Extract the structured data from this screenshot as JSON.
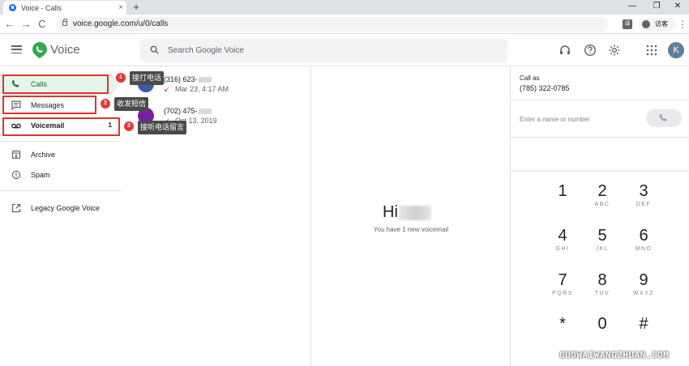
{
  "browser": {
    "tab_title": "Voice - Calls",
    "tab_close": "×",
    "new_tab": "+",
    "minimize": "—",
    "restore": "❐",
    "close": "✕",
    "back": "←",
    "forward": "→",
    "reload": "C",
    "url": "voice.google.com/u/0/calls",
    "translate_icon": "译",
    "profile_label": "访客",
    "menu": "⋮"
  },
  "header": {
    "app_name": "Voice",
    "search_placeholder": "Search Google Voice",
    "avatar_initial": "K"
  },
  "nav": {
    "calls": "Calls",
    "messages": "Messages",
    "voicemail": "Voicemail",
    "voicemail_count": "1",
    "archive": "Archive",
    "spam": "Spam",
    "legacy": "Legacy Google Voice"
  },
  "annotations": [
    {
      "num": "1",
      "text": "接打电话"
    },
    {
      "num": "2",
      "text": "收发短信"
    },
    {
      "num": "3",
      "text": "接听电话留言"
    }
  ],
  "calls": [
    {
      "number": "(316) 623-",
      "date": "Mar 23, 4:17 AM",
      "arrow": "↙"
    },
    {
      "number": "(702) 475-",
      "date": "Oct 13, 2019",
      "arrow": "↙"
    }
  ],
  "center": {
    "greeting": "Hi",
    "note": "You have 1 new voicemail"
  },
  "dialer": {
    "call_as_label": "Call as",
    "call_as_number": "(785) 322-0785",
    "input_placeholder": "Enter a name or number",
    "keys": [
      {
        "d": "1",
        "l": ""
      },
      {
        "d": "2",
        "l": "ABC"
      },
      {
        "d": "3",
        "l": "DEF"
      },
      {
        "d": "4",
        "l": "GHI"
      },
      {
        "d": "5",
        "l": "JKL"
      },
      {
        "d": "6",
        "l": "MNO"
      },
      {
        "d": "7",
        "l": "PQRS"
      },
      {
        "d": "8",
        "l": "TUV"
      },
      {
        "d": "9",
        "l": "WXYZ"
      },
      {
        "d": "*",
        "l": ""
      },
      {
        "d": "0",
        "l": ""
      },
      {
        "d": "#",
        "l": ""
      }
    ]
  },
  "watermark": "GUOWAIWANGZHUAN.COM",
  "colors": {
    "accent_green": "#137333",
    "active_bg": "#e6f4ea",
    "annotation_red": "#e0322f"
  }
}
